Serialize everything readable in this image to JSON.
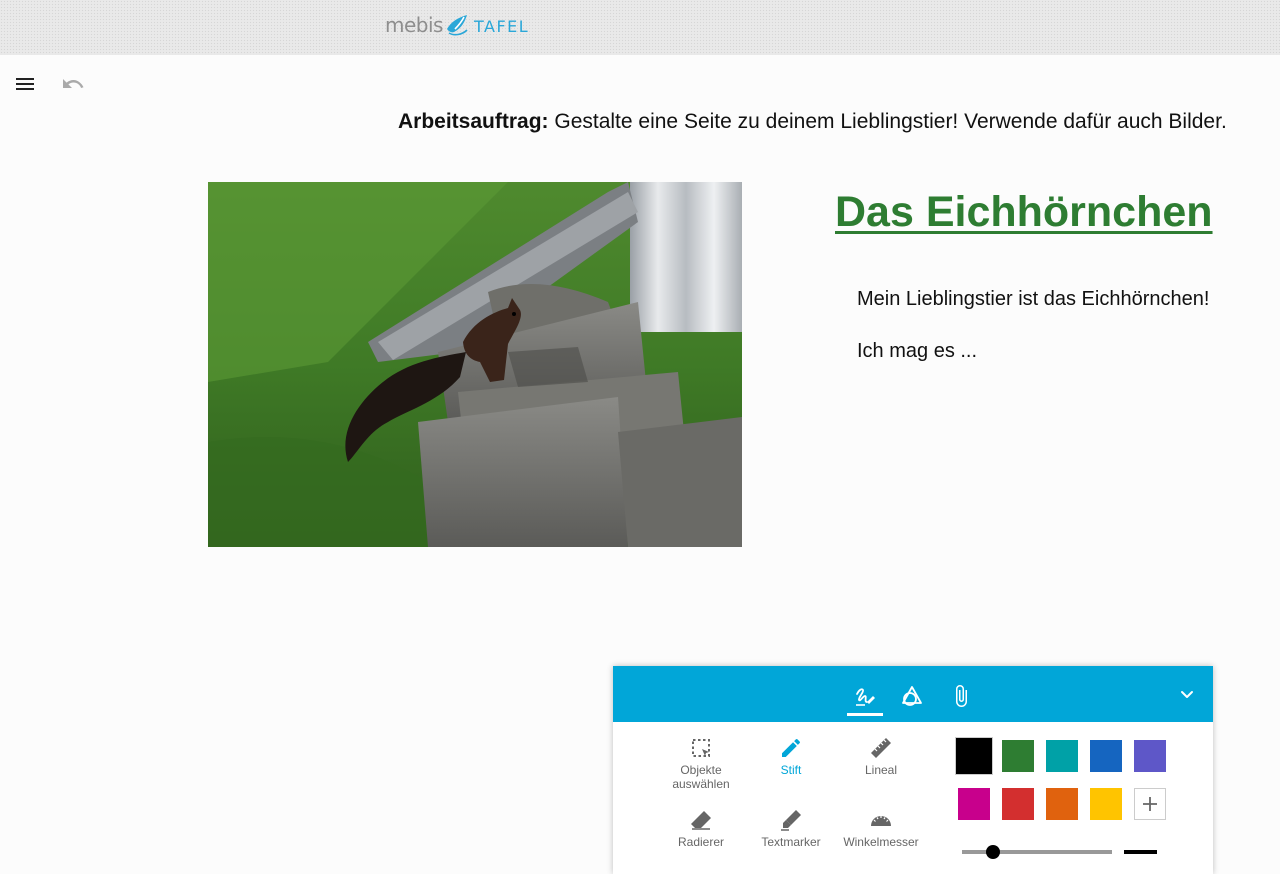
{
  "app": {
    "logo_left": "mebis",
    "logo_right": "TAFEL"
  },
  "canvas": {
    "task_bold": "Arbeitsauftrag:",
    "task_text": " Gestalte eine Seite zu deinem Lieblingstier! Verwende dafür auch Bilder.",
    "heading": "Das Eichhörnchen",
    "paragraph_1": "Mein Lieblingstier ist das Eichhörnchen!",
    "paragraph_2": "Ich mag es ..."
  },
  "toolbar": {
    "tabs": [
      {
        "icon": "pen-scribble-icon",
        "active": true
      },
      {
        "icon": "geometry-shapes-icon",
        "active": false
      },
      {
        "icon": "paperclip-icon",
        "active": false
      }
    ],
    "tools": [
      {
        "label": "Objekte auswählen",
        "icon": "select-objects-icon"
      },
      {
        "label": "Stift",
        "icon": "pen-icon",
        "active": true
      },
      {
        "label": "Lineal",
        "icon": "ruler-icon"
      },
      {
        "label": "Radierer",
        "icon": "eraser-icon"
      },
      {
        "label": "Textmarker",
        "icon": "highlighter-icon"
      },
      {
        "label": "Winkelmesser",
        "icon": "protractor-icon"
      }
    ],
    "colors": [
      "#000000",
      "#2e7d32",
      "#00a1a7",
      "#1565c0",
      "#5e57c8",
      "#c8008c",
      "#d32f2f",
      "#e0620e",
      "#ffc400"
    ],
    "selected_color": "#000000",
    "stroke_width_level": 0.18
  },
  "theme": {
    "accent": "#01a6d8",
    "heading_green": "#2e7d32"
  }
}
